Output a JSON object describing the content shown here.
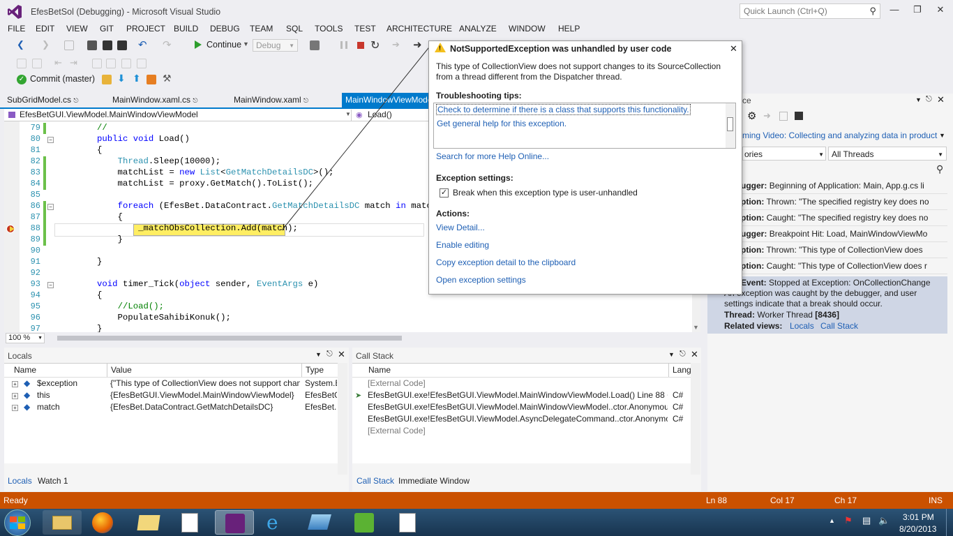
{
  "window": {
    "title": "EfesBetSol (Debugging) - Microsoft Visual Studio",
    "quick_launch_placeholder": "Quick Launch (Ctrl+Q)"
  },
  "menu": [
    "FILE",
    "EDIT",
    "VIEW",
    "GIT",
    "PROJECT",
    "BUILD",
    "DEBUG",
    "TEAM",
    "SQL",
    "TOOLS",
    "TEST",
    "ARCHITECTURE",
    "ANALYZE",
    "WINDOW",
    "HELP"
  ],
  "toolbar": {
    "continue_label": "Continue",
    "config_value": "Debug",
    "commit_label": "Commit (master)"
  },
  "tabs": [
    "SubGridModel.cs",
    "MainWindow.xaml.cs",
    "MainWindow.xaml",
    "MainWindowViewModel.cs"
  ],
  "navbar": {
    "class": "EfesBetGUI.ViewModel.MainWindowViewModel",
    "member": "Load()"
  },
  "editor": {
    "zoom": "100 %",
    "lines": [
      {
        "n": "79",
        "parts": [
          {
            "t": "        "
          },
          {
            "t": "//",
            "c": "cm"
          }
        ]
      },
      {
        "n": "80",
        "parts": [
          {
            "t": "        "
          },
          {
            "t": "public",
            "c": "kw"
          },
          {
            "t": " "
          },
          {
            "t": "void",
            "c": "kw"
          },
          {
            "t": " Load()"
          }
        ]
      },
      {
        "n": "81",
        "parts": [
          {
            "t": "        {"
          }
        ]
      },
      {
        "n": "82",
        "parts": [
          {
            "t": "            "
          },
          {
            "t": "Thread",
            "c": "ty"
          },
          {
            "t": ".Sleep(10000);"
          }
        ]
      },
      {
        "n": "83",
        "parts": [
          {
            "t": "            matchList = "
          },
          {
            "t": "new",
            "c": "kw"
          },
          {
            "t": " "
          },
          {
            "t": "List",
            "c": "ty"
          },
          {
            "t": "<"
          },
          {
            "t": "GetMatchDetailsDC",
            "c": "ty"
          },
          {
            "t": ">();"
          }
        ]
      },
      {
        "n": "84",
        "parts": [
          {
            "t": "            matchList = proxy.GetMatch().ToList();"
          }
        ]
      },
      {
        "n": "85",
        "parts": [
          {
            "t": ""
          }
        ]
      },
      {
        "n": "86",
        "parts": [
          {
            "t": "            "
          },
          {
            "t": "foreach",
            "c": "kw"
          },
          {
            "t": " (EfesBet.DataContract."
          },
          {
            "t": "GetMatchDetailsDC",
            "c": "ty"
          },
          {
            "t": " match "
          },
          {
            "t": "in",
            "c": "kw"
          },
          {
            "t": " matchList)"
          }
        ]
      },
      {
        "n": "87",
        "parts": [
          {
            "t": "            {"
          }
        ]
      },
      {
        "n": "88",
        "parts": [
          {
            "t": "                _matchObsCollection.Add(match);"
          }
        ]
      },
      {
        "n": "89",
        "parts": [
          {
            "t": "            }"
          }
        ]
      },
      {
        "n": "90",
        "parts": [
          {
            "t": ""
          }
        ]
      },
      {
        "n": "91",
        "parts": [
          {
            "t": "        }"
          }
        ]
      },
      {
        "n": "92",
        "parts": [
          {
            "t": ""
          }
        ]
      },
      {
        "n": "93",
        "parts": [
          {
            "t": "        "
          },
          {
            "t": "void",
            "c": "kw"
          },
          {
            "t": " timer_Tick("
          },
          {
            "t": "object",
            "c": "kw"
          },
          {
            "t": " sender, "
          },
          {
            "t": "EventArgs",
            "c": "ty"
          },
          {
            "t": " e)"
          }
        ]
      },
      {
        "n": "94",
        "parts": [
          {
            "t": "        {"
          }
        ]
      },
      {
        "n": "95",
        "parts": [
          {
            "t": "            "
          },
          {
            "t": "//Load();",
            "c": "cm"
          }
        ]
      },
      {
        "n": "96",
        "parts": [
          {
            "t": "            PopulateSahibiKonuk();"
          }
        ]
      },
      {
        "n": "97",
        "parts": [
          {
            "t": "        }"
          }
        ]
      }
    ]
  },
  "locals": {
    "title": "Locals",
    "columns": [
      "Name",
      "Value",
      "Type"
    ],
    "rows": [
      {
        "name": "$exception",
        "value": "{\"This type of CollectionView does not support chan",
        "type": "System.E"
      },
      {
        "name": "this",
        "value": "{EfesBetGUI.ViewModel.MainWindowViewModel}",
        "type": "EfesBetG"
      },
      {
        "name": "match",
        "value": "{EfesBet.DataContract.GetMatchDetailsDC}",
        "type": "EfesBet.D"
      }
    ],
    "tabs": [
      "Locals",
      "Watch 1"
    ]
  },
  "callstack": {
    "title": "Call Stack",
    "columns": [
      "Name",
      "Lang"
    ],
    "rows": [
      {
        "name": "[External Code]",
        "lang": ""
      },
      {
        "name": "EfesBetGUI.exe!EfesBetGUI.ViewModel.MainWindowViewModel.Load() Line 88 + 0x",
        "lang": "C#"
      },
      {
        "name": "EfesBetGUI.exe!EfesBetGUI.ViewModel.MainWindowViewModel..ctor.AnonymousM",
        "lang": "C#"
      },
      {
        "name": "EfesBetGUI.exe!EfesBetGUI.ViewModel.AsyncDelegateCommand..ctor.Anonymous",
        "lang": "C#"
      },
      {
        "name": "[External Code]",
        "lang": ""
      }
    ],
    "tabs": [
      "Call Stack",
      "Immediate Window"
    ]
  },
  "intellitrace": {
    "title": "ce",
    "video_link": "ming Video: Collecting and analyzing data in product",
    "filter_category": "ories",
    "filter_threads": "All Threads",
    "events": [
      {
        "cat": "ugger:",
        "text": "Beginning of Application: Main, App.g.cs li"
      },
      {
        "cat": "ption:",
        "text": "Thrown: \"The specified registry key does no"
      },
      {
        "cat": "ption:",
        "text": "Caught: \"The specified registry key does no"
      },
      {
        "cat": "ugger:",
        "text": "Breakpoint Hit: Load, MainWindowViewMo"
      },
      {
        "cat": "ption:",
        "text": "Thrown: \"This type of CollectionView does"
      },
      {
        "cat": "ption:",
        "text": "Caught: \"This type of CollectionView does r"
      }
    ],
    "selected": {
      "event_label": "Event:",
      "event_text": "Stopped at Exception: OnCollectionChange",
      "desc1": "An exception was caught by the debugger, and user",
      "desc2": "settings indicate that a break should occur.",
      "thread_label": "Thread:",
      "thread_prefix": "Worker Thread ",
      "thread_id": "[8436]",
      "related_label": "Related views:",
      "related_links": [
        "Locals",
        "Call Stack"
      ]
    }
  },
  "exception": {
    "title": "NotSupportedException was unhandled by user code",
    "message1": "This type of CollectionView does not support changes to its SourceCollection",
    "message2": "from a thread different from the Dispatcher thread.",
    "tips_header": "Troubleshooting tips:",
    "tips": [
      "Check to determine if there is a class that supports this functionality.",
      "Get general help for this exception."
    ],
    "search_online": "Search for more Help Online...",
    "settings_header": "Exception settings:",
    "break_checkbox": "Break when this exception type is user-unhandled",
    "actions_header": "Actions:",
    "actions": [
      "View Detail...",
      "Enable editing",
      "Copy exception detail to the clipboard",
      "Open exception settings"
    ]
  },
  "status": {
    "text": "Ready",
    "ln": "Ln 88",
    "col": "Col 17",
    "ch": "Ch 17",
    "mode": "INS"
  },
  "taskbar": {
    "time": "3:01 PM",
    "date": "8/20/2013"
  },
  "colors": {
    "accent": "#007acc",
    "status_debug": "#ca5100",
    "link": "#1e5fb4"
  }
}
